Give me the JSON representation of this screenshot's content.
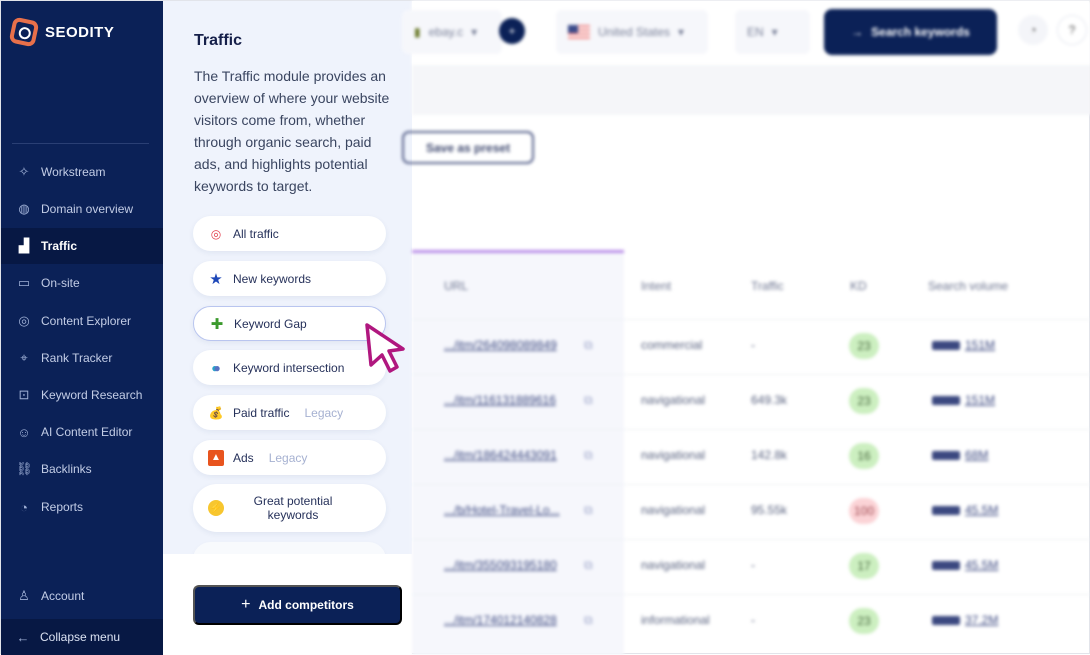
{
  "brand": {
    "name": "SEODITY",
    "accent": "#e8704a",
    "navy": "#0b2157"
  },
  "sidebar": {
    "items": [
      {
        "label": "Workstream",
        "icon": "sparkle-icon"
      },
      {
        "label": "Domain overview",
        "icon": "globe-icon"
      },
      {
        "label": "Traffic",
        "icon": "chart-icon",
        "active": true
      },
      {
        "label": "On-site",
        "icon": "window-icon"
      },
      {
        "label": "Content Explorer",
        "icon": "explore-icon"
      },
      {
        "label": "Rank Tracker",
        "icon": "crosshair-icon"
      },
      {
        "label": "Keyword Research",
        "icon": "search-box-icon"
      },
      {
        "label": "AI Content Editor",
        "icon": "robot-icon"
      },
      {
        "label": "Backlinks",
        "icon": "link-icon"
      },
      {
        "label": "Reports",
        "icon": "pie-icon"
      }
    ],
    "account": "Account",
    "collapse": "Collapse menu"
  },
  "panel": {
    "title": "Traffic",
    "description": "The Traffic module provides an overview of where your website visitors come from, whether through organic search, paid ads, and highlights potential keywords to target.",
    "items": [
      {
        "label": "All traffic",
        "tag": ""
      },
      {
        "label": "New keywords",
        "tag": ""
      },
      {
        "label": "Keyword Gap",
        "tag": ""
      },
      {
        "label": "Keyword intersection",
        "tag": ""
      },
      {
        "label": "Paid traffic",
        "tag": "Legacy"
      },
      {
        "label": "Ads",
        "tag": "Legacy"
      },
      {
        "label": "Great potential keywords",
        "tag": ""
      }
    ],
    "add_competitors": "Add competitors"
  },
  "topbar": {
    "domain": "ebay.c",
    "country": "United States",
    "language": "EN",
    "search": "Search keywords"
  },
  "toolbar": {
    "save_preset": "Save as preset"
  },
  "table": {
    "headers": {
      "url": "URL",
      "intent": "Intent",
      "traffic": "Traffic",
      "kd": "KD",
      "volume": "Search volume"
    },
    "rows": [
      {
        "url": ".../itm/264098089849",
        "intent": "commercial",
        "traffic": "-",
        "kd": "23",
        "volume": "151M"
      },
      {
        "url": ".../itm/116131889616",
        "intent": "navigational",
        "traffic": "649.3k",
        "kd": "23",
        "volume": "151M"
      },
      {
        "url": ".../itm/186424443091",
        "intent": "navigational",
        "traffic": "142.8k",
        "kd": "16",
        "volume": "68M"
      },
      {
        "url": ".../b/Hotel-Travel-Lo...",
        "intent": "navigational",
        "traffic": "95.55k",
        "kd": "100",
        "volume": "45.5M"
      },
      {
        "url": ".../itm/355093195180",
        "intent": "navigational",
        "traffic": "-",
        "kd": "17",
        "volume": "45.5M"
      },
      {
        "url": ".../itm/174012140828",
        "intent": "informational",
        "traffic": "-",
        "kd": "23",
        "volume": "37.2M"
      }
    ]
  }
}
